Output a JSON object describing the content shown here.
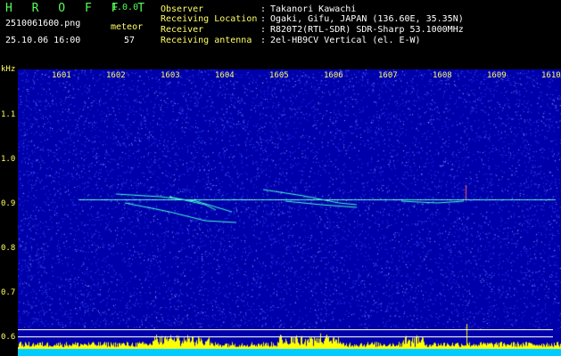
{
  "header": {
    "app_name": "H R O F F T",
    "app_version": "1.0.0",
    "filename": "2510061600.png",
    "meteor_label": "meteor",
    "datetime": "25.10.06 16:00",
    "meteor_count": "57"
  },
  "info": [
    {
      "label": "Observer",
      "sep": ":",
      "value": "Takanori Kawachi"
    },
    {
      "label": "Receiving Location",
      "sep": ":",
      "value": "Ogaki, Gifu, JAPAN (136.60E, 35.35N)"
    },
    {
      "label": "Receiver",
      "sep": ":",
      "value": "R820T2(RTL-SDR) SDR-Sharp 53.1000MHz"
    },
    {
      "label": "Receiving antenna",
      "sep": ":",
      "value": "2el-HB9CV Vertical (el. E-W)"
    }
  ],
  "axes": {
    "y_unit": "kHz",
    "x_ticks": [
      "1601",
      "1602",
      "1603",
      "1604",
      "1605",
      "1606",
      "1607",
      "1608",
      "1609",
      "1610"
    ],
    "y_ticks": [
      "1.1",
      "1.0",
      "0.9",
      "0.8",
      "0.7",
      "0.6"
    ]
  },
  "colors": {
    "background": "#0000aa",
    "text_green": "#55ff55",
    "text_yellow": "#ffff66",
    "echo": "#44ffcc",
    "level_bars": "#ffff00",
    "level_base": "#00ccff"
  }
}
